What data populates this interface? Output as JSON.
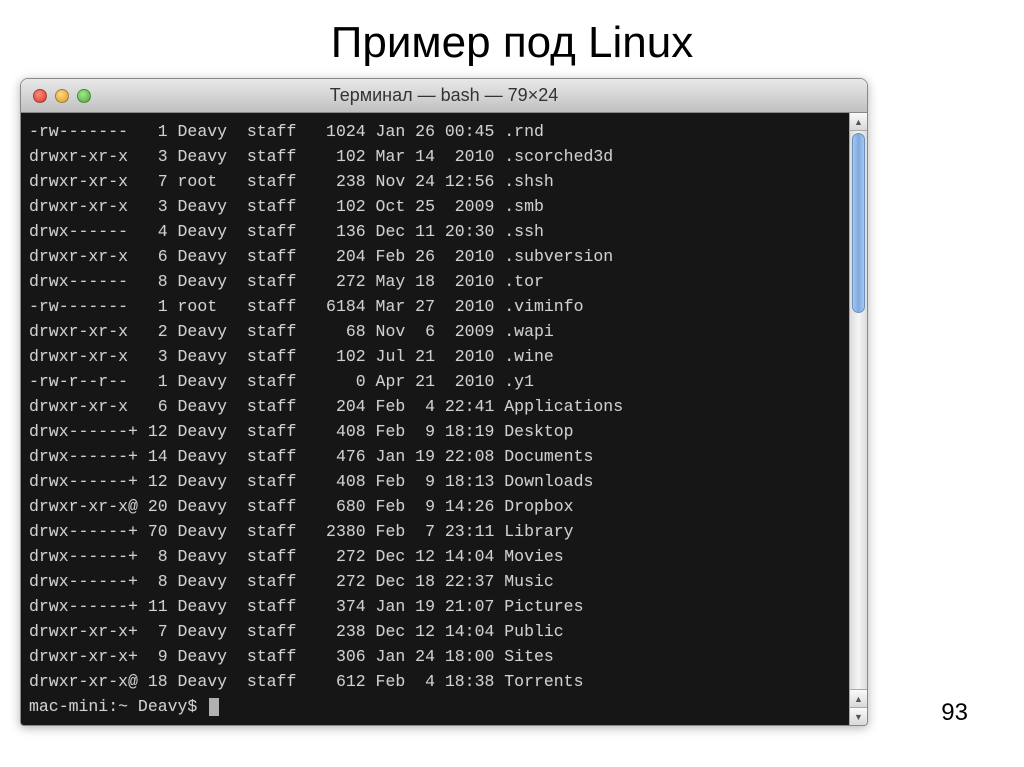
{
  "slide": {
    "title": "Пример под Linux",
    "page_number": "93"
  },
  "window": {
    "title": "Терминал — bash — 79×24"
  },
  "terminal": {
    "rows": [
      {
        "perm": "-rw-------",
        "links": "1",
        "owner": "Deavy",
        "group": "staff",
        "size": "1024",
        "date": "Jan 26 00:45",
        "name": ".rnd"
      },
      {
        "perm": "drwxr-xr-x",
        "links": "3",
        "owner": "Deavy",
        "group": "staff",
        "size": "102",
        "date": "Mar 14  2010",
        "name": ".scorched3d"
      },
      {
        "perm": "drwxr-xr-x",
        "links": "7",
        "owner": "root ",
        "group": "staff",
        "size": "238",
        "date": "Nov 24 12:56",
        "name": ".shsh"
      },
      {
        "perm": "drwxr-xr-x",
        "links": "3",
        "owner": "Deavy",
        "group": "staff",
        "size": "102",
        "date": "Oct 25  2009",
        "name": ".smb"
      },
      {
        "perm": "drwx------",
        "links": "4",
        "owner": "Deavy",
        "group": "staff",
        "size": "136",
        "date": "Dec 11 20:30",
        "name": ".ssh"
      },
      {
        "perm": "drwxr-xr-x",
        "links": "6",
        "owner": "Deavy",
        "group": "staff",
        "size": "204",
        "date": "Feb 26  2010",
        "name": ".subversion"
      },
      {
        "perm": "drwx------",
        "links": "8",
        "owner": "Deavy",
        "group": "staff",
        "size": "272",
        "date": "May 18  2010",
        "name": ".tor"
      },
      {
        "perm": "-rw-------",
        "links": "1",
        "owner": "root ",
        "group": "staff",
        "size": "6184",
        "date": "Mar 27  2010",
        "name": ".viminfo"
      },
      {
        "perm": "drwxr-xr-x",
        "links": "2",
        "owner": "Deavy",
        "group": "staff",
        "size": "68",
        "date": "Nov  6  2009",
        "name": ".wapi"
      },
      {
        "perm": "drwxr-xr-x",
        "links": "3",
        "owner": "Deavy",
        "group": "staff",
        "size": "102",
        "date": "Jul 21  2010",
        "name": ".wine"
      },
      {
        "perm": "-rw-r--r--",
        "links": "1",
        "owner": "Deavy",
        "group": "staff",
        "size": "0",
        "date": "Apr 21  2010",
        "name": ".y1"
      },
      {
        "perm": "drwxr-xr-x",
        "links": "6",
        "owner": "Deavy",
        "group": "staff",
        "size": "204",
        "date": "Feb  4 22:41",
        "name": "Applications"
      },
      {
        "perm": "drwx------+",
        "links": "12",
        "owner": "Deavy",
        "group": "staff",
        "size": "408",
        "date": "Feb  9 18:19",
        "name": "Desktop"
      },
      {
        "perm": "drwx------+",
        "links": "14",
        "owner": "Deavy",
        "group": "staff",
        "size": "476",
        "date": "Jan 19 22:08",
        "name": "Documents"
      },
      {
        "perm": "drwx------+",
        "links": "12",
        "owner": "Deavy",
        "group": "staff",
        "size": "408",
        "date": "Feb  9 18:13",
        "name": "Downloads"
      },
      {
        "perm": "drwxr-xr-x@",
        "links": "20",
        "owner": "Deavy",
        "group": "staff",
        "size": "680",
        "date": "Feb  9 14:26",
        "name": "Dropbox"
      },
      {
        "perm": "drwx------+",
        "links": "70",
        "owner": "Deavy",
        "group": "staff",
        "size": "2380",
        "date": "Feb  7 23:11",
        "name": "Library"
      },
      {
        "perm": "drwx------+",
        "links": "8",
        "owner": "Deavy",
        "group": "staff",
        "size": "272",
        "date": "Dec 12 14:04",
        "name": "Movies"
      },
      {
        "perm": "drwx------+",
        "links": "8",
        "owner": "Deavy",
        "group": "staff",
        "size": "272",
        "date": "Dec 18 22:37",
        "name": "Music"
      },
      {
        "perm": "drwx------+",
        "links": "11",
        "owner": "Deavy",
        "group": "staff",
        "size": "374",
        "date": "Jan 19 21:07",
        "name": "Pictures"
      },
      {
        "perm": "drwxr-xr-x+",
        "links": "7",
        "owner": "Deavy",
        "group": "staff",
        "size": "238",
        "date": "Dec 12 14:04",
        "name": "Public"
      },
      {
        "perm": "drwxr-xr-x+",
        "links": "9",
        "owner": "Deavy",
        "group": "staff",
        "size": "306",
        "date": "Jan 24 18:00",
        "name": "Sites"
      },
      {
        "perm": "drwxr-xr-x@",
        "links": "18",
        "owner": "Deavy",
        "group": "staff",
        "size": "612",
        "date": "Feb  4 18:38",
        "name": "Torrents"
      }
    ],
    "prompt": "mac-mini:~ Deavy$ "
  }
}
